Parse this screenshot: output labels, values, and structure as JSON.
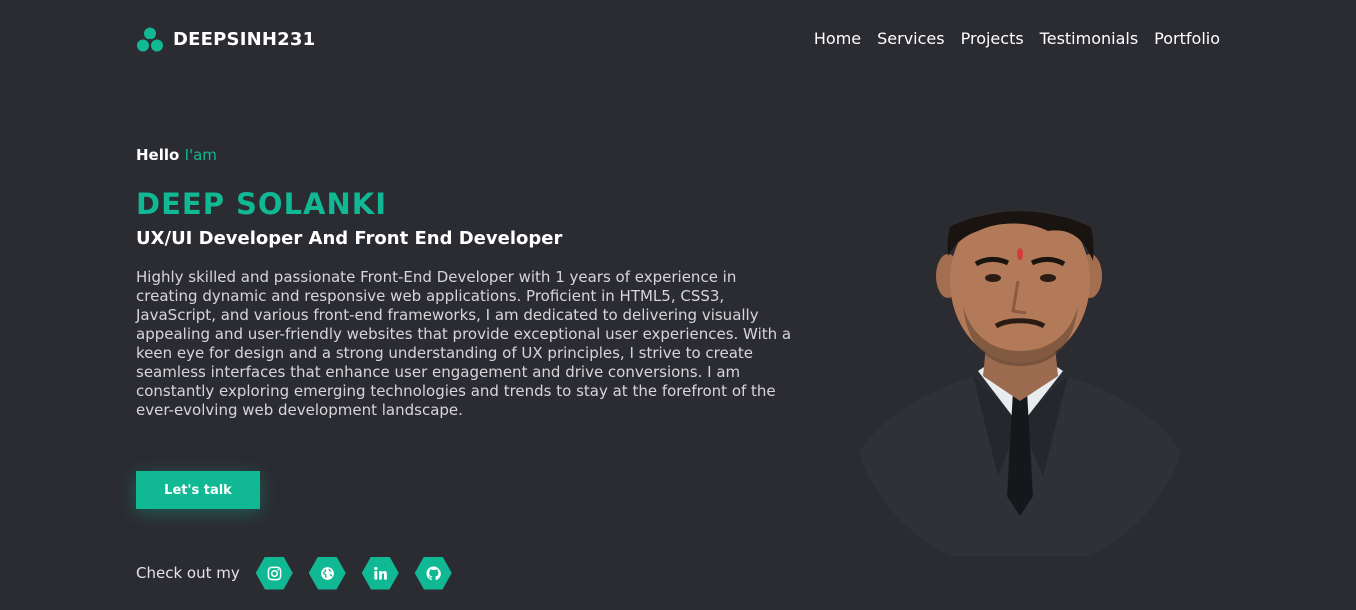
{
  "brand": {
    "name": "DEEPSINH231",
    "logo_icon": "three-circles-logo-icon"
  },
  "nav": {
    "items": [
      "Home",
      "Services",
      "Projects",
      "Testimonials",
      "Portfolio"
    ]
  },
  "hero": {
    "greeting": "Hello",
    "greeting_accent": "I'am",
    "name": "DEEP SOLANKI",
    "role": "UX/UI Developer And Front End Developer",
    "bio": "Highly skilled and passionate Front-End Developer with 1 years of experience in creating dynamic and responsive web applications. Proficient in HTML5, CSS3, JavaScript, and various front-end frameworks, I am dedicated to delivering visually appealing and user-friendly websites that provide exceptional user experiences. With a keen eye for design and a strong understanding of UX principles, I strive to create seamless interfaces that enhance user engagement and drive conversions. I am constantly exploring emerging technologies and trends to stay at the forefront of the ever-evolving web development landscape.",
    "cta_label": "Let's talk"
  },
  "socials": {
    "label": "Check out my",
    "icons": [
      "instagram-icon",
      "globe-icon",
      "linkedin-icon",
      "github-icon"
    ]
  },
  "colors": {
    "background": "#2b2b32",
    "accent": "#10b894",
    "text": "#ffffff"
  }
}
